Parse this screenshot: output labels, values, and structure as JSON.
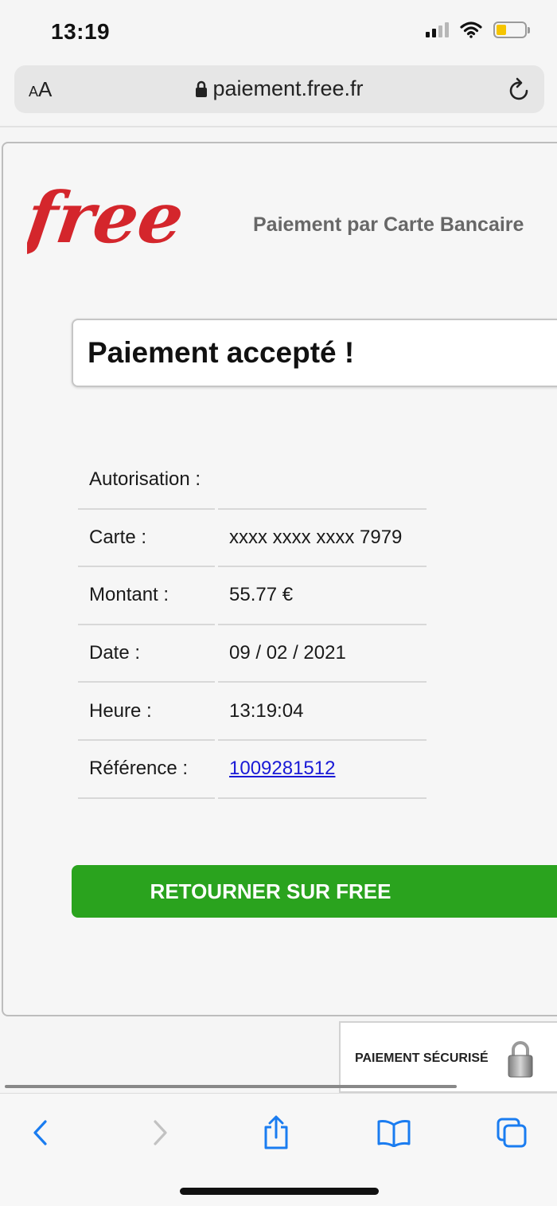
{
  "status_bar": {
    "time": "13:19"
  },
  "browser": {
    "text_size_button": "AA",
    "url": "paiement.free.fr"
  },
  "page": {
    "logo_text": "free",
    "subtitle": "Paiement par Carte Bancaire",
    "status_message": "Paiement accepté !",
    "details": [
      {
        "label": "Autorisation :",
        "value": ""
      },
      {
        "label": "Carte :",
        "value": "xxxx xxxx xxxx 7979"
      },
      {
        "label": "Montant :",
        "value": "55.77 €"
      },
      {
        "label": "Date :",
        "value": "09 / 02 / 2021"
      },
      {
        "label": "Heure :",
        "value": "13:19:04"
      },
      {
        "label": "Référence :",
        "value": "1009281512"
      }
    ],
    "return_button": "RETOURNER SUR FREE",
    "secure_badge": "PAIEMENT SÉCURISÉ"
  },
  "colors": {
    "brand_red": "#d4262c",
    "button_green": "#2aa31e",
    "ios_blue": "#1a7cf0",
    "link_blue": "#1a1ad6"
  },
  "icons": {
    "url_lock": "lock-icon",
    "reload": "reload-icon",
    "back": "chevron-left-icon",
    "forward": "chevron-right-icon",
    "share": "share-icon",
    "bookmarks": "book-icon",
    "tabs": "tabs-icon",
    "secure": "padlock-icon"
  }
}
